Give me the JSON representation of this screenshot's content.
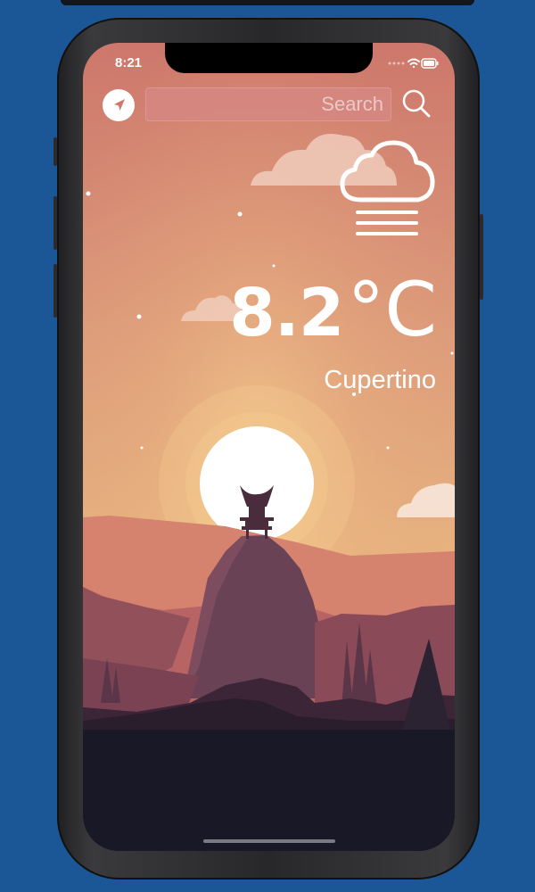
{
  "status_bar": {
    "time": "8:21"
  },
  "search": {
    "placeholder": "Search",
    "value": ""
  },
  "weather": {
    "temperature": "8.2",
    "unit": "°C",
    "city": "Cupertino",
    "condition_icon": "fog-cloud-icon"
  },
  "icons": {
    "location": "location-arrow-icon",
    "search": "magnifier-icon"
  },
  "colors": {
    "background": "#1b5797",
    "sky_top": "#cd776c",
    "sky_bottom": "#e6b27f",
    "sun": "#ffffff",
    "ground": "#181826"
  }
}
